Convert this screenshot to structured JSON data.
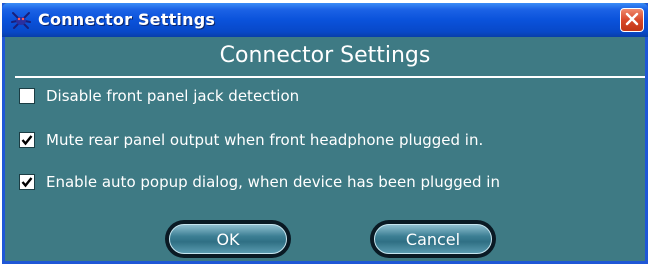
{
  "window": {
    "title": "Connector Settings",
    "close_icon": "close-icon",
    "app_icon": "realtek-crab-icon"
  },
  "heading": "Connector Settings",
  "options": [
    {
      "label": "Disable front panel jack detection",
      "checked": false
    },
    {
      "label": "Mute rear panel output when front headphone plugged in.",
      "checked": true
    },
    {
      "label": "Enable auto popup dialog, when device has been plugged in",
      "checked": true
    }
  ],
  "buttons": {
    "ok_label": "OK",
    "cancel_label": "Cancel"
  },
  "colors": {
    "panel": "#3e7a84",
    "titlebar": "#0a52db",
    "close": "#d8482a"
  }
}
